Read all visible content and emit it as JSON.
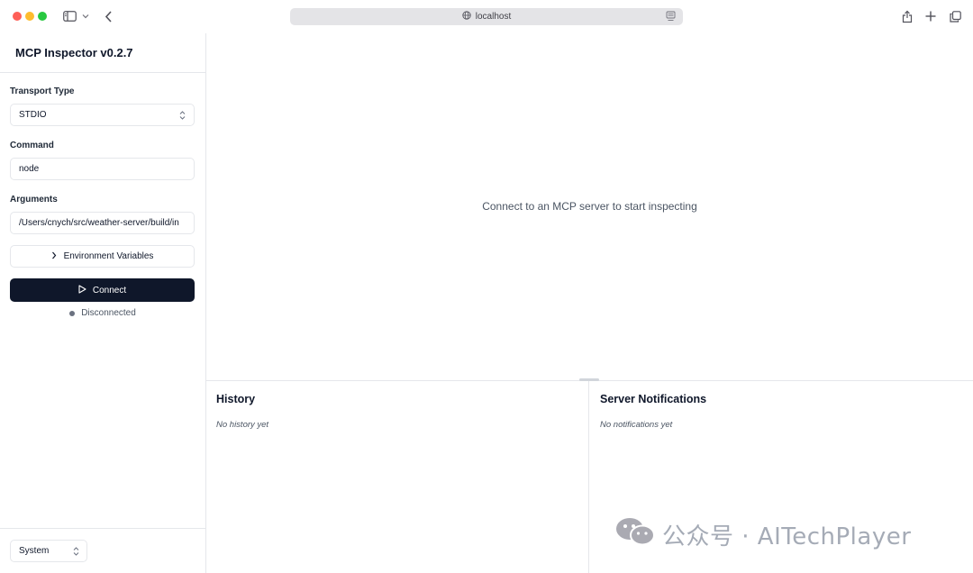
{
  "browser": {
    "url": "localhost"
  },
  "sidebar": {
    "app_title": "MCP Inspector v0.2.7",
    "transport_type": {
      "label": "Transport Type",
      "value": "STDIO"
    },
    "command": {
      "label": "Command",
      "value": "node"
    },
    "arguments": {
      "label": "Arguments",
      "value": "/Users/cnych/src/weather-server/build/in"
    },
    "env_button_label": "Environment Variables",
    "connect_button_label": "Connect",
    "connection_status": "Disconnected",
    "theme_select_value": "System"
  },
  "main": {
    "placeholder": "Connect to an MCP server to start inspecting",
    "history": {
      "title": "History",
      "empty_text": "No history yet"
    },
    "notifications": {
      "title": "Server Notifications",
      "empty_text": "No notifications yet"
    }
  },
  "watermark": {
    "text": "公众号 · AITechPlayer"
  },
  "colors": {
    "primary_button": "#0f172a",
    "status_dot": "#6b7280",
    "border": "#e5e7eb"
  }
}
